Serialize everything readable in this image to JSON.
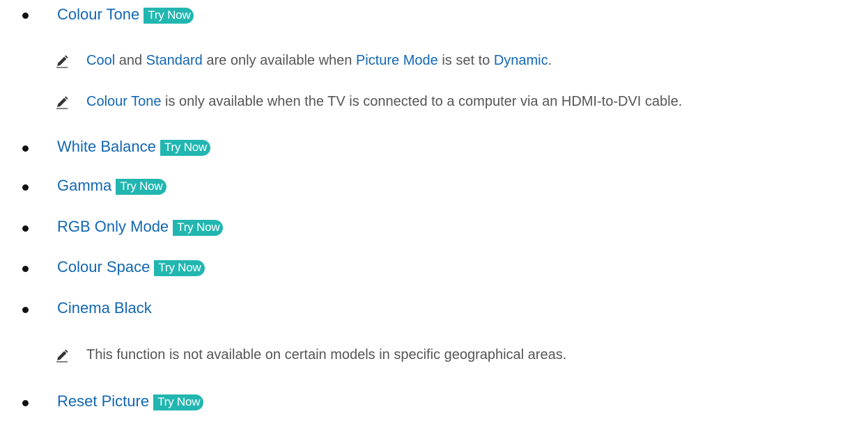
{
  "try_now_label": "Try Now",
  "items": [
    {
      "label": "Colour Tone",
      "try_now": true
    },
    {
      "label": "White Balance",
      "try_now": true
    },
    {
      "label": "Gamma",
      "try_now": true
    },
    {
      "label": "RGB Only Mode",
      "try_now": true
    },
    {
      "label": "Colour Space",
      "try_now": true
    },
    {
      "label": "Cinema Black",
      "try_now": false
    },
    {
      "label": "Reset Picture",
      "try_now": true
    }
  ],
  "notes": {
    "colour_tone_1": {
      "p1": "Cool",
      "p2": " and ",
      "p3": "Standard",
      "p4": " are only available when ",
      "p5": "Picture Mode",
      "p6": " is set to ",
      "p7": "Dynamic",
      "p8": "."
    },
    "colour_tone_2": {
      "p1": "Colour Tone",
      "p2": " is only available when the TV is connected to a computer via an HDMI-to-DVI cable."
    },
    "cinema_black": "This function is not available on certain models in specific geographical areas."
  },
  "colors": {
    "link": "#1267b3",
    "try_now_bg": "#22b6b0",
    "body_text": "#555555",
    "bullet": "#111111"
  },
  "icons": {
    "note": "pencil-icon",
    "bullet": "bullet-dot"
  }
}
